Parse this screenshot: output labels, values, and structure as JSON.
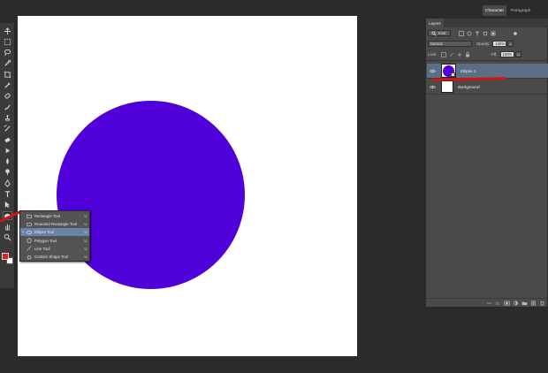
{
  "colors": {
    "ellipse_fill": "#5000d9",
    "foreground": "#ea1e1e",
    "background": "#ffffff",
    "selection": "#5c6e86",
    "annotation_red": "#d11414"
  },
  "toolbar": {
    "tools": [
      "move-tool",
      "marquee-tool",
      "lasso-tool",
      "quick-selection-tool",
      "crop-tool",
      "eyedropper-tool",
      "spot-healing-tool",
      "brush-tool",
      "clone-stamp-tool",
      "history-brush-tool",
      "eraser-tool",
      "gradient-tool",
      "blur-tool",
      "dodge-tool",
      "pen-tool",
      "type-tool",
      "path-selection-tool",
      "shape-tool",
      "hand-tool",
      "zoom-tool"
    ]
  },
  "flyout": {
    "items": [
      {
        "label": "Rectangle Tool",
        "key": "U",
        "icon": "rectangle-icon",
        "selected": false
      },
      {
        "label": "Rounded Rectangle Tool",
        "key": "U",
        "icon": "rounded-rectangle-icon",
        "selected": false
      },
      {
        "label": "Ellipse Tool",
        "key": "U",
        "icon": "ellipse-icon",
        "selected": true
      },
      {
        "label": "Polygon Tool",
        "key": "U",
        "icon": "polygon-icon",
        "selected": false
      },
      {
        "label": "Line Tool",
        "key": "U",
        "icon": "line-icon",
        "selected": false
      },
      {
        "label": "Custom Shape Tool",
        "key": "U",
        "icon": "custom-shape-icon",
        "selected": false
      }
    ]
  },
  "panels": {
    "top_tabs": [
      "Character",
      "Paragraph"
    ],
    "layers_tab": "Layers",
    "filter_kind": "Kind",
    "blend_mode": "Normal",
    "opacity_label": "Opacity:",
    "opacity_value": "100%",
    "lock_label": "Lock:",
    "fill_label": "Fill:",
    "fill_value": "100%",
    "layers": [
      {
        "name": "Ellipse 1",
        "selected": true,
        "italic": false
      },
      {
        "name": "Background",
        "selected": false,
        "italic": true
      }
    ]
  }
}
